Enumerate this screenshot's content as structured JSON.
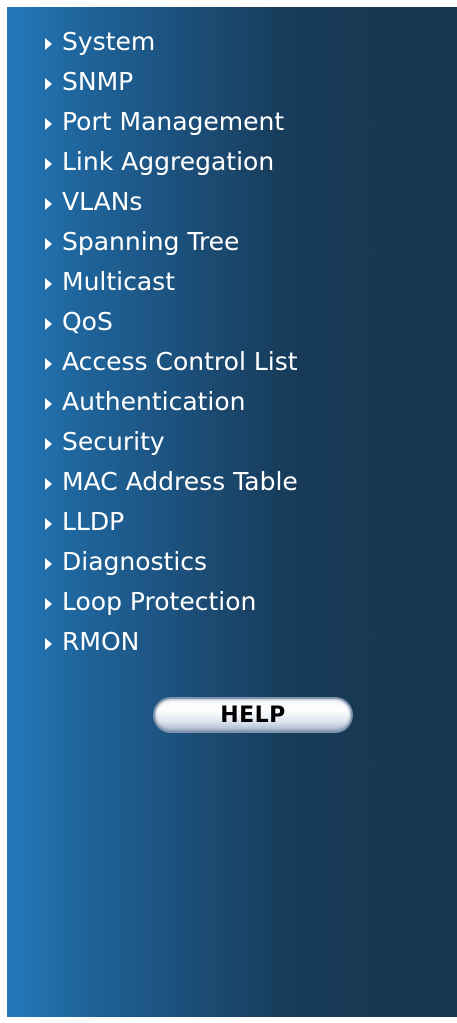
{
  "menu": {
    "items": [
      {
        "label": "System"
      },
      {
        "label": "SNMP"
      },
      {
        "label": "Port Management"
      },
      {
        "label": "Link Aggregation"
      },
      {
        "label": "VLANs"
      },
      {
        "label": "Spanning Tree"
      },
      {
        "label": "Multicast"
      },
      {
        "label": "QoS"
      },
      {
        "label": "Access Control List"
      },
      {
        "label": "Authentication"
      },
      {
        "label": "Security"
      },
      {
        "label": "MAC Address Table"
      },
      {
        "label": "LLDP"
      },
      {
        "label": "Diagnostics"
      },
      {
        "label": "Loop Protection"
      },
      {
        "label": "RMON"
      }
    ],
    "arrow_icon": "triangle-right-icon"
  },
  "help": {
    "label": "HELP"
  },
  "colors": {
    "gradient_left": "#2478ba",
    "gradient_right": "#16374f",
    "text": "#ffffff"
  }
}
